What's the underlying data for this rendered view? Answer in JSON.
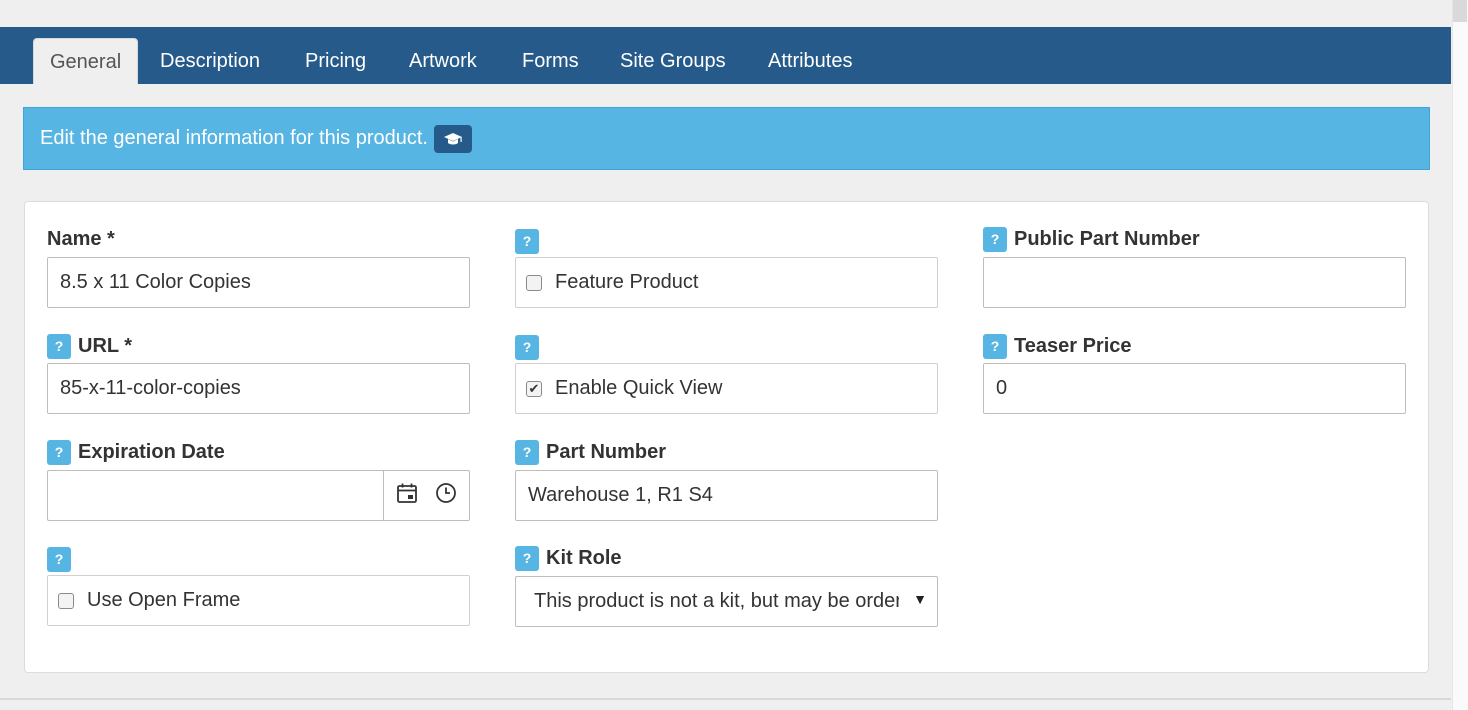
{
  "tabs": [
    {
      "label": "General",
      "active": true
    },
    {
      "label": "Description"
    },
    {
      "label": "Pricing"
    },
    {
      "label": "Artwork"
    },
    {
      "label": "Forms"
    },
    {
      "label": "Site Groups"
    },
    {
      "label": "Attributes"
    }
  ],
  "banner": {
    "text": "Edit the general information for this product.",
    "help_icon": "graduation-cap-icon"
  },
  "help_badge": "?",
  "fields": {
    "name": {
      "label": "Name *",
      "value": "8.5 x 11 Color Copies"
    },
    "url": {
      "label": "URL *",
      "value": "85-x-11-color-copies"
    },
    "expiration_date": {
      "label": "Expiration Date",
      "value": ""
    },
    "use_open_frame": {
      "label": "Use Open Frame",
      "checked": false
    },
    "feature_product": {
      "label": "Feature Product",
      "checked": false
    },
    "enable_quick_view": {
      "label": "Enable Quick View",
      "checked": true
    },
    "part_number": {
      "label": "Part Number",
      "value": "Warehouse 1, R1 S4"
    },
    "kit_role": {
      "label": "Kit Role",
      "value": "This product is not a kit, but may be ordered as part of a kit"
    },
    "public_part_number": {
      "label": "Public Part Number",
      "value": ""
    },
    "teaser_price": {
      "label": "Teaser Price",
      "value": "0"
    }
  },
  "colors": {
    "tab_bar": "#255a8a",
    "banner": "#56b5e3",
    "help_badge": "#56b5e3"
  }
}
